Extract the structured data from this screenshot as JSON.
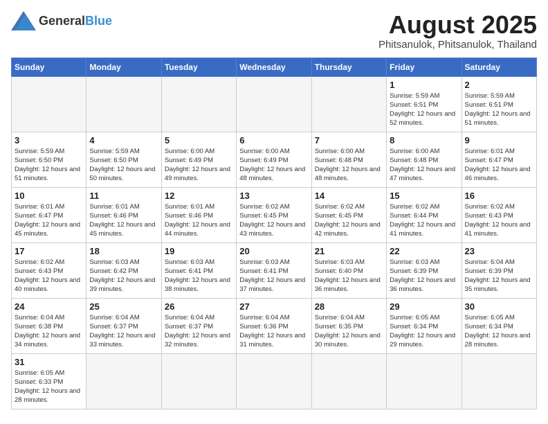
{
  "header": {
    "logo_general": "General",
    "logo_blue": "Blue",
    "month_title": "August 2025",
    "location": "Phitsanulok, Phitsanulok, Thailand"
  },
  "days_of_week": [
    "Sunday",
    "Monday",
    "Tuesday",
    "Wednesday",
    "Thursday",
    "Friday",
    "Saturday"
  ],
  "weeks": [
    [
      {
        "day": "",
        "info": ""
      },
      {
        "day": "",
        "info": ""
      },
      {
        "day": "",
        "info": ""
      },
      {
        "day": "",
        "info": ""
      },
      {
        "day": "",
        "info": ""
      },
      {
        "day": "1",
        "info": "Sunrise: 5:59 AM\nSunset: 6:51 PM\nDaylight: 12 hours and 52 minutes."
      },
      {
        "day": "2",
        "info": "Sunrise: 5:59 AM\nSunset: 6:51 PM\nDaylight: 12 hours and 51 minutes."
      }
    ],
    [
      {
        "day": "3",
        "info": "Sunrise: 5:59 AM\nSunset: 6:50 PM\nDaylight: 12 hours and 51 minutes."
      },
      {
        "day": "4",
        "info": "Sunrise: 5:59 AM\nSunset: 6:50 PM\nDaylight: 12 hours and 50 minutes."
      },
      {
        "day": "5",
        "info": "Sunrise: 6:00 AM\nSunset: 6:49 PM\nDaylight: 12 hours and 49 minutes."
      },
      {
        "day": "6",
        "info": "Sunrise: 6:00 AM\nSunset: 6:49 PM\nDaylight: 12 hours and 48 minutes."
      },
      {
        "day": "7",
        "info": "Sunrise: 6:00 AM\nSunset: 6:48 PM\nDaylight: 12 hours and 48 minutes."
      },
      {
        "day": "8",
        "info": "Sunrise: 6:00 AM\nSunset: 6:48 PM\nDaylight: 12 hours and 47 minutes."
      },
      {
        "day": "9",
        "info": "Sunrise: 6:01 AM\nSunset: 6:47 PM\nDaylight: 12 hours and 46 minutes."
      }
    ],
    [
      {
        "day": "10",
        "info": "Sunrise: 6:01 AM\nSunset: 6:47 PM\nDaylight: 12 hours and 45 minutes."
      },
      {
        "day": "11",
        "info": "Sunrise: 6:01 AM\nSunset: 6:46 PM\nDaylight: 12 hours and 45 minutes."
      },
      {
        "day": "12",
        "info": "Sunrise: 6:01 AM\nSunset: 6:46 PM\nDaylight: 12 hours and 44 minutes."
      },
      {
        "day": "13",
        "info": "Sunrise: 6:02 AM\nSunset: 6:45 PM\nDaylight: 12 hours and 43 minutes."
      },
      {
        "day": "14",
        "info": "Sunrise: 6:02 AM\nSunset: 6:45 PM\nDaylight: 12 hours and 42 minutes."
      },
      {
        "day": "15",
        "info": "Sunrise: 6:02 AM\nSunset: 6:44 PM\nDaylight: 12 hours and 41 minutes."
      },
      {
        "day": "16",
        "info": "Sunrise: 6:02 AM\nSunset: 6:43 PM\nDaylight: 12 hours and 41 minutes."
      }
    ],
    [
      {
        "day": "17",
        "info": "Sunrise: 6:02 AM\nSunset: 6:43 PM\nDaylight: 12 hours and 40 minutes."
      },
      {
        "day": "18",
        "info": "Sunrise: 6:03 AM\nSunset: 6:42 PM\nDaylight: 12 hours and 39 minutes."
      },
      {
        "day": "19",
        "info": "Sunrise: 6:03 AM\nSunset: 6:41 PM\nDaylight: 12 hours and 38 minutes."
      },
      {
        "day": "20",
        "info": "Sunrise: 6:03 AM\nSunset: 6:41 PM\nDaylight: 12 hours and 37 minutes."
      },
      {
        "day": "21",
        "info": "Sunrise: 6:03 AM\nSunset: 6:40 PM\nDaylight: 12 hours and 36 minutes."
      },
      {
        "day": "22",
        "info": "Sunrise: 6:03 AM\nSunset: 6:39 PM\nDaylight: 12 hours and 36 minutes."
      },
      {
        "day": "23",
        "info": "Sunrise: 6:04 AM\nSunset: 6:39 PM\nDaylight: 12 hours and 35 minutes."
      }
    ],
    [
      {
        "day": "24",
        "info": "Sunrise: 6:04 AM\nSunset: 6:38 PM\nDaylight: 12 hours and 34 minutes."
      },
      {
        "day": "25",
        "info": "Sunrise: 6:04 AM\nSunset: 6:37 PM\nDaylight: 12 hours and 33 minutes."
      },
      {
        "day": "26",
        "info": "Sunrise: 6:04 AM\nSunset: 6:37 PM\nDaylight: 12 hours and 32 minutes."
      },
      {
        "day": "27",
        "info": "Sunrise: 6:04 AM\nSunset: 6:36 PM\nDaylight: 12 hours and 31 minutes."
      },
      {
        "day": "28",
        "info": "Sunrise: 6:04 AM\nSunset: 6:35 PM\nDaylight: 12 hours and 30 minutes."
      },
      {
        "day": "29",
        "info": "Sunrise: 6:05 AM\nSunset: 6:34 PM\nDaylight: 12 hours and 29 minutes."
      },
      {
        "day": "30",
        "info": "Sunrise: 6:05 AM\nSunset: 6:34 PM\nDaylight: 12 hours and 28 minutes."
      }
    ],
    [
      {
        "day": "31",
        "info": "Sunrise: 6:05 AM\nSunset: 6:33 PM\nDaylight: 12 hours and 28 minutes."
      },
      {
        "day": "",
        "info": ""
      },
      {
        "day": "",
        "info": ""
      },
      {
        "day": "",
        "info": ""
      },
      {
        "day": "",
        "info": ""
      },
      {
        "day": "",
        "info": ""
      },
      {
        "day": "",
        "info": ""
      }
    ]
  ]
}
